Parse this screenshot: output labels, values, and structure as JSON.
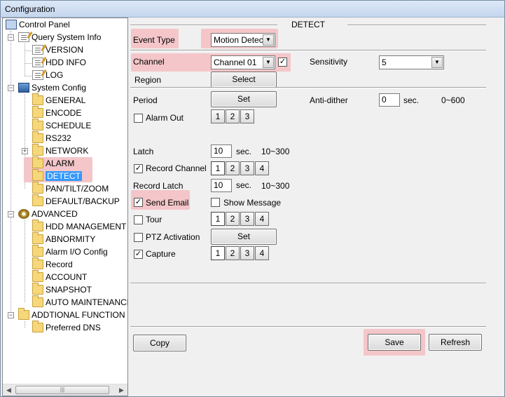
{
  "window_title": "Configuration",
  "tree": {
    "root": "Control Panel",
    "query": "Query System Info",
    "version": "VERSION",
    "hdd_info": "HDD INFO",
    "log": "LOG",
    "system_config": "System Config",
    "general": "GENERAL",
    "encode": "ENCODE",
    "schedule": "SCHEDULE",
    "rs232": "RS232",
    "network": "NETWORK",
    "alarm": "ALARM",
    "detect": "DETECT",
    "pan": "PAN/TILT/ZOOM",
    "default": "DEFAULT/BACKUP",
    "advanced": "ADVANCED",
    "hdd_mgmt": "HDD MANAGEMENT",
    "abnormity": "ABNORMITY",
    "alarm_io": "Alarm I/O Config",
    "record": "Record",
    "account": "ACCOUNT",
    "snapshot": "SNAPSHOT",
    "auto_maint": "AUTO MAINTENANCE",
    "additional": "ADDTIONAL FUNCTION",
    "pref_dns": "Preferred DNS"
  },
  "section_title": "DETECT",
  "form": {
    "event_type_label": "Event Type",
    "event_type_value": "Motion Detect",
    "channel_label": "Channel",
    "channel_value": "Channel 01",
    "sensitivity_label": "Sensitivity",
    "sensitivity_value": "5",
    "region_label": "Region",
    "region_btn": "Select",
    "period_label": "Period",
    "period_btn": "Set",
    "antidither_label": "Anti-dither",
    "antidither_value": "0",
    "sec": "sec.",
    "antidither_range": "0~600",
    "alarm_out_label": "Alarm Out",
    "latch_label": "Latch",
    "latch_value": "10",
    "latch_range": "10~300",
    "record_channel_label": "Record Channel",
    "record_latch_label": "Record Latch",
    "record_latch_value": "10",
    "record_latch_range": "10~300",
    "send_email_label": "Send Email",
    "show_message_label": "Show Message",
    "tour_label": "Tour",
    "ptz_label": "PTZ Activation",
    "ptz_btn": "Set",
    "capture_label": "Capture",
    "n1": "1",
    "n2": "2",
    "n3": "3",
    "n4": "4"
  },
  "buttons": {
    "copy": "Copy",
    "save": "Save",
    "refresh": "Refresh"
  },
  "highlight_color": "#f4c6c9",
  "selection_color": "#3399ff"
}
